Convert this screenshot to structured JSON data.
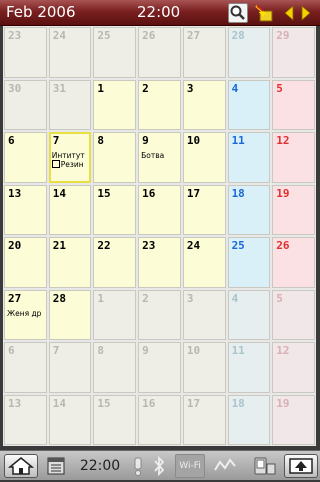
{
  "header": {
    "month_year": "Feb 2006",
    "time": "22:00",
    "search_icon": "search-icon",
    "today_icon": "goto-today-icon",
    "prev_icon": "arrow-left-icon",
    "next_icon": "arrow-right-icon"
  },
  "calendar": {
    "weeks": [
      [
        {
          "d": "23",
          "t": "out"
        },
        {
          "d": "24",
          "t": "out"
        },
        {
          "d": "25",
          "t": "out"
        },
        {
          "d": "26",
          "t": "out"
        },
        {
          "d": "27",
          "t": "out"
        },
        {
          "d": "28",
          "t": "sat out"
        },
        {
          "d": "29",
          "t": "sun out"
        }
      ],
      [
        {
          "d": "30",
          "t": "out"
        },
        {
          "d": "31",
          "t": "out"
        },
        {
          "d": "1",
          "t": "cur"
        },
        {
          "d": "2",
          "t": "cur"
        },
        {
          "d": "3",
          "t": "cur"
        },
        {
          "d": "4",
          "t": "sat"
        },
        {
          "d": "5",
          "t": "sun"
        }
      ],
      [
        {
          "d": "6",
          "t": "cur"
        },
        {
          "d": "7",
          "t": "cur today",
          "events": [
            "Интитут",
            "Резин"
          ]
        },
        {
          "d": "8",
          "t": "cur"
        },
        {
          "d": "9",
          "t": "cur",
          "events": [
            "Ботва"
          ]
        },
        {
          "d": "10",
          "t": "cur"
        },
        {
          "d": "11",
          "t": "sat"
        },
        {
          "d": "12",
          "t": "sun"
        }
      ],
      [
        {
          "d": "13",
          "t": "cur"
        },
        {
          "d": "14",
          "t": "cur"
        },
        {
          "d": "15",
          "t": "cur"
        },
        {
          "d": "16",
          "t": "cur"
        },
        {
          "d": "17",
          "t": "cur"
        },
        {
          "d": "18",
          "t": "sat"
        },
        {
          "d": "19",
          "t": "sun"
        }
      ],
      [
        {
          "d": "20",
          "t": "cur"
        },
        {
          "d": "21",
          "t": "cur"
        },
        {
          "d": "22",
          "t": "cur"
        },
        {
          "d": "23",
          "t": "cur"
        },
        {
          "d": "24",
          "t": "cur"
        },
        {
          "d": "25",
          "t": "sat"
        },
        {
          "d": "26",
          "t": "sun"
        }
      ],
      [
        {
          "d": "27",
          "t": "cur",
          "events": [
            "Женя др"
          ]
        },
        {
          "d": "28",
          "t": "cur"
        },
        {
          "d": "1",
          "t": "out"
        },
        {
          "d": "2",
          "t": "out"
        },
        {
          "d": "3",
          "t": "out"
        },
        {
          "d": "4",
          "t": "sat out"
        },
        {
          "d": "5",
          "t": "sun out"
        }
      ],
      [
        {
          "d": "6",
          "t": "out"
        },
        {
          "d": "7",
          "t": "out"
        },
        {
          "d": "8",
          "t": "out"
        },
        {
          "d": "9",
          "t": "out"
        },
        {
          "d": "10",
          "t": "out"
        },
        {
          "d": "11",
          "t": "sat out"
        },
        {
          "d": "12",
          "t": "sun out"
        }
      ],
      [
        {
          "d": "13",
          "t": "out"
        },
        {
          "d": "14",
          "t": "out"
        },
        {
          "d": "15",
          "t": "out"
        },
        {
          "d": "16",
          "t": "out"
        },
        {
          "d": "17",
          "t": "out"
        },
        {
          "d": "18",
          "t": "sat out"
        },
        {
          "d": "19",
          "t": "sun out"
        }
      ]
    ],
    "checkbox_event_cell": "7",
    "colors": {
      "weekday_bg": "#fcfcd6",
      "saturday_bg": "#d9f0f8",
      "sunday_bg": "#fbe0e4",
      "saturday_text": "#1a68d8",
      "sunday_text": "#e03030",
      "today_outline": "#e8e040"
    }
  },
  "statusbar": {
    "time": "22:00",
    "wifi_label": "Wi-Fi",
    "icons": [
      "home-icon",
      "task-manager-icon",
      "alert-icon",
      "bluetooth-icon",
      "wifi-icon",
      "network-icon",
      "pda-icon",
      "screen-rotate-icon"
    ]
  },
  "theme": {
    "header_color": "#7a2020"
  }
}
